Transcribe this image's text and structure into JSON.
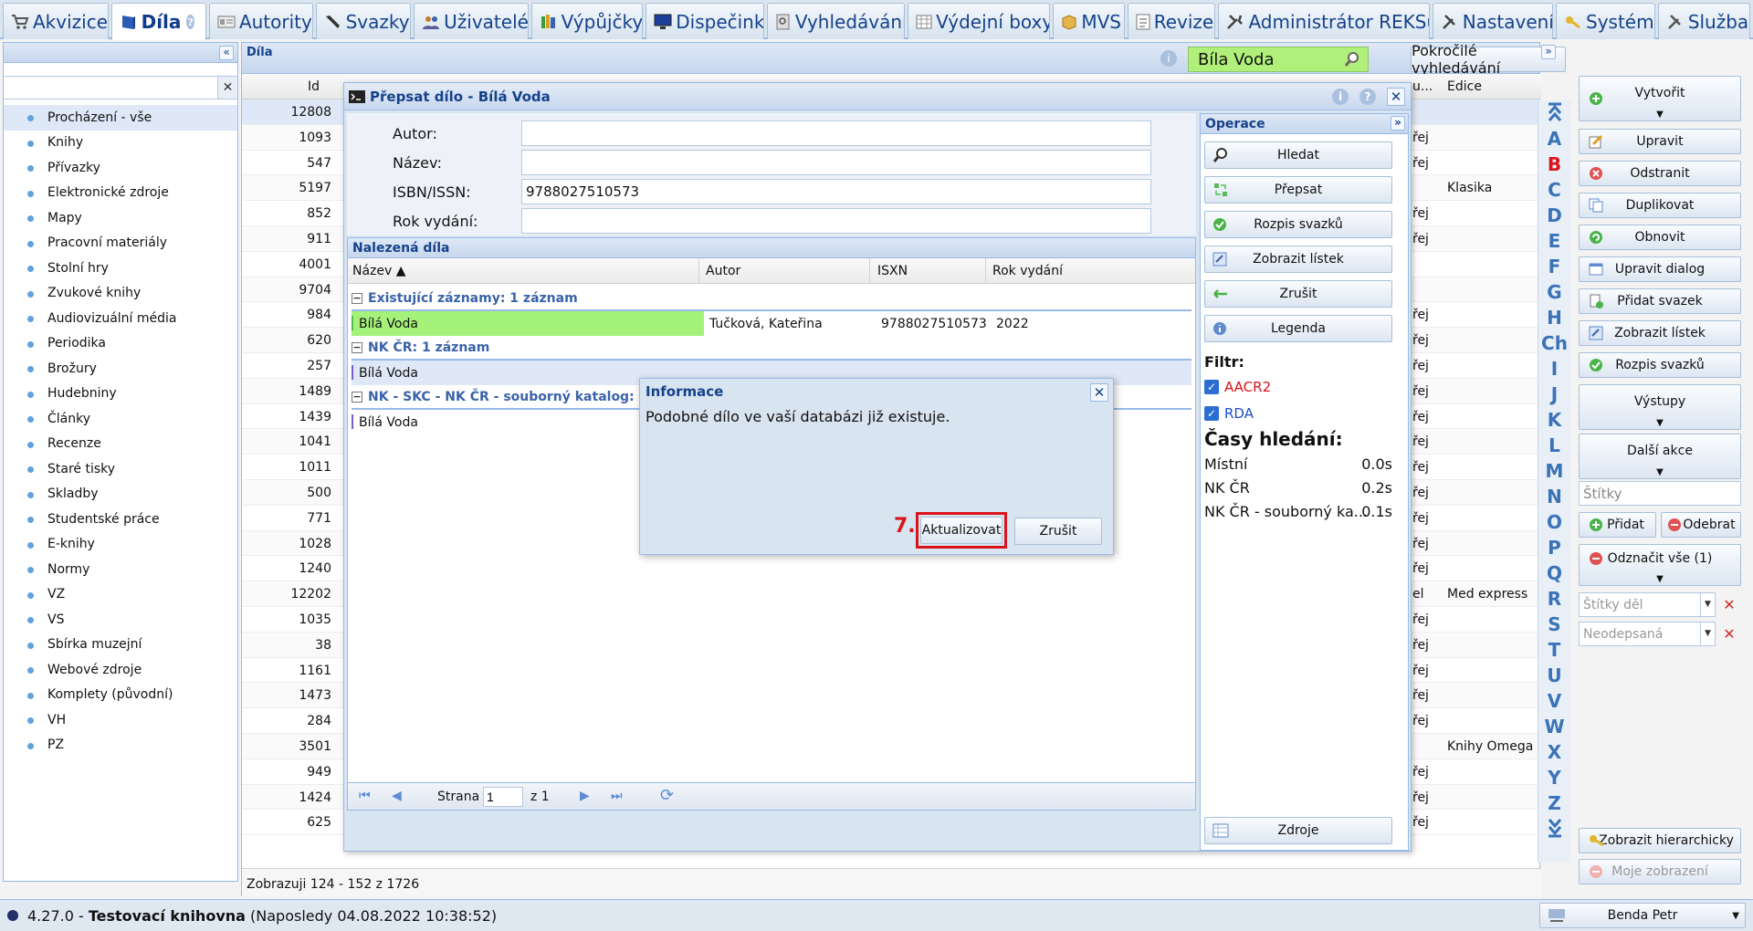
{
  "tabs": [
    {
      "label": "Akvizice",
      "icon": "cart-icon",
      "active": false
    },
    {
      "label": "Díla",
      "icon": "book-icon",
      "active": true
    },
    {
      "label": "Autority",
      "icon": "card-icon",
      "active": false
    },
    {
      "label": "Svazky",
      "icon": "pen-icon",
      "active": false
    },
    {
      "label": "Uživatelé",
      "icon": "users-icon",
      "active": false
    },
    {
      "label": "Výpůjčky",
      "icon": "books-icon",
      "active": false
    },
    {
      "label": "Dispečink",
      "icon": "monitor-icon",
      "active": false
    },
    {
      "label": "Vyhledávání",
      "icon": "search-doc-icon",
      "active": false
    },
    {
      "label": "Výdejní boxy",
      "icon": "grid-icon",
      "active": false
    },
    {
      "label": "MVS",
      "icon": "box-icon",
      "active": false
    },
    {
      "label": "Revize",
      "icon": "checklist-icon",
      "active": false
    },
    {
      "label": "Administrátor REKSu",
      "icon": "tools-icon",
      "active": false
    },
    {
      "label": "Nastavení",
      "icon": "wrench-icon",
      "active": false
    },
    {
      "label": "Systém",
      "icon": "key-icon",
      "active": false
    },
    {
      "label": "Služba",
      "icon": "service-icon",
      "active": false
    }
  ],
  "left": {
    "search_value": "",
    "categories": [
      "Procházení - vše",
      "Knihy",
      "Přívazky",
      "Elektronické zdroje",
      "Mapy",
      "Pracovní materiály",
      "Stolní hry",
      "Zvukové knihy",
      "Audiovizuální média",
      "Periodika",
      "Brožury",
      "Hudebniny",
      "Články",
      "Recenze",
      "Staré tisky",
      "Skladby",
      "Studentské práce",
      "E-knihy",
      "Normy",
      "VZ",
      "VS",
      "Sbírka muzejní",
      "Webové zdroje",
      "Komplety (původní)",
      "VH",
      "PZ"
    ]
  },
  "main": {
    "title": "Díla",
    "search_value": "Bíla Voda",
    "advanced_label": "Pokročilé vyhledávání",
    "col_id": "Id",
    "col_partial": "u...",
    "col_edice": "Edice",
    "rows": [
      {
        "id": "12808",
        "r": "",
        "e": ""
      },
      {
        "id": "1093",
        "r": "řej",
        "e": ""
      },
      {
        "id": "547",
        "r": "řej",
        "e": ""
      },
      {
        "id": "5197",
        "r": "",
        "e": "Klasika"
      },
      {
        "id": "852",
        "r": "řej",
        "e": ""
      },
      {
        "id": "911",
        "r": "řej",
        "e": ""
      },
      {
        "id": "4001",
        "r": "",
        "e": ""
      },
      {
        "id": "9704",
        "r": "",
        "e": ""
      },
      {
        "id": "984",
        "r": "řej",
        "e": ""
      },
      {
        "id": "620",
        "r": "řej",
        "e": ""
      },
      {
        "id": "257",
        "r": "řej",
        "e": ""
      },
      {
        "id": "1489",
        "r": "řej",
        "e": ""
      },
      {
        "id": "1439",
        "r": "řej",
        "e": ""
      },
      {
        "id": "1041",
        "r": "řej",
        "e": ""
      },
      {
        "id": "1011",
        "r": "řej",
        "e": ""
      },
      {
        "id": "500",
        "r": "řej",
        "e": ""
      },
      {
        "id": "771",
        "r": "řej",
        "e": ""
      },
      {
        "id": "1028",
        "r": "řej",
        "e": ""
      },
      {
        "id": "1240",
        "r": "řej",
        "e": ""
      },
      {
        "id": "12202",
        "r": "el",
        "e": "Med express"
      },
      {
        "id": "1035",
        "r": "řej",
        "e": ""
      },
      {
        "id": "38",
        "r": "řej",
        "e": ""
      },
      {
        "id": "1161",
        "r": "řej",
        "e": ""
      },
      {
        "id": "1473",
        "r": "řej",
        "e": ""
      },
      {
        "id": "284",
        "r": "řej",
        "e": ""
      },
      {
        "id": "3501",
        "r": "",
        "e": "Knihy Omega"
      },
      {
        "id": "949",
        "r": "řej",
        "e": ""
      },
      {
        "id": "1424",
        "r": "řej",
        "e": ""
      },
      {
        "id": "625",
        "r": "řej",
        "e": ""
      }
    ],
    "footer": "Zobrazuji 124 - 152 z 1726"
  },
  "alphabet": [
    "A",
    "B",
    "C",
    "D",
    "E",
    "F",
    "G",
    "H",
    "Ch",
    "I",
    "J",
    "K",
    "L",
    "M",
    "N",
    "O",
    "P",
    "Q",
    "R",
    "S",
    "T",
    "U",
    "V",
    "W",
    "X",
    "Y",
    "Z"
  ],
  "right": {
    "create": "Vytvořit",
    "edit": "Upravit",
    "remove": "Odstranit",
    "duplicate": "Duplikovat",
    "refresh": "Obnovit",
    "edit_dialog": "Upravit dialog",
    "add_volume": "Přidat svazek",
    "show_card": "Zobrazit lístek",
    "volumes": "Rozpis svazků",
    "outputs": "Výstupy",
    "more": "Další akce",
    "tags_placeholder": "Štítky",
    "add": "Přidat",
    "subtract": "Odebrat",
    "unmark": "Odznačit vše (1)",
    "work_tags_placeholder": "Štítky děl",
    "unsigned_placeholder": "Neodepsaná",
    "hierarchy": "Zobrazit hierarchicky",
    "my_view": "Moje zobrazení"
  },
  "dialog": {
    "title": "Přepsat dílo - Bílá Voda",
    "fields": [
      {
        "label": "Autor:",
        "value": ""
      },
      {
        "label": "Název:",
        "value": ""
      },
      {
        "label": "ISBN/ISSN:",
        "value": "9788027510573"
      },
      {
        "label": "Rok vydání:",
        "value": ""
      }
    ],
    "found_title": "Nalezená díla",
    "cols": {
      "name": "Název ▲",
      "author": "Autor",
      "isxn": "ISXN",
      "year": "Rok vydání"
    },
    "groups": [
      {
        "label": "Existující záznamy: 1 záznam",
        "row": {
          "name": "Bílá Voda",
          "author": "Tučková, Kateřina",
          "isxn": "9788027510573",
          "year": "2022"
        }
      },
      {
        "label": "NK ČR: 1 záznam",
        "row": {
          "name": "Bílá Voda",
          "author": "",
          "isxn": "",
          "year": ""
        }
      },
      {
        "label": "NK - SKC - NK ČR - souborný katalog: 1 zá",
        "row": {
          "name": "Bílá Voda",
          "author": "",
          "isxn": "",
          "year": ""
        }
      }
    ],
    "pager": {
      "label": "Strana",
      "page": "1",
      "of": "z 1"
    },
    "ops": {
      "title": "Operace",
      "search": "Hledat",
      "overwrite": "Přepsat",
      "volumes": "Rozpis svazků",
      "show_card": "Zobrazit lístek",
      "cancel": "Zrušit",
      "legend": "Legenda",
      "filter_label": "Filtr:",
      "filters": [
        {
          "label": "AACR2",
          "color": "#d9141b"
        },
        {
          "label": "RDA",
          "color": "#1f4fc9"
        }
      ],
      "times_title": "Časy hledání:",
      "times": [
        {
          "label": "Místní",
          "value": "0.0s"
        },
        {
          "label": "NK ČR",
          "value": "0.2s"
        },
        {
          "label": "NK ČR - souborný ka...",
          "value": "0.1s"
        }
      ],
      "sources": "Zdroje"
    }
  },
  "info": {
    "title": "Informace",
    "message": "Podobné dílo ve vaší databázi již existuje.",
    "step": "7.",
    "update": "Aktualizovat",
    "cancel": "Zrušit"
  },
  "status": {
    "version": "4.27.0 - ",
    "library": "Testovací knihovna",
    "last": " (Naposledy 04.08.2022 10:38:52)",
    "user": "Benda Petr"
  },
  "colors": {
    "accent": "#15428b",
    "highlight_green": "#a5f27a",
    "search_green": "#b0f07a",
    "alert_red": "#d9141b"
  }
}
